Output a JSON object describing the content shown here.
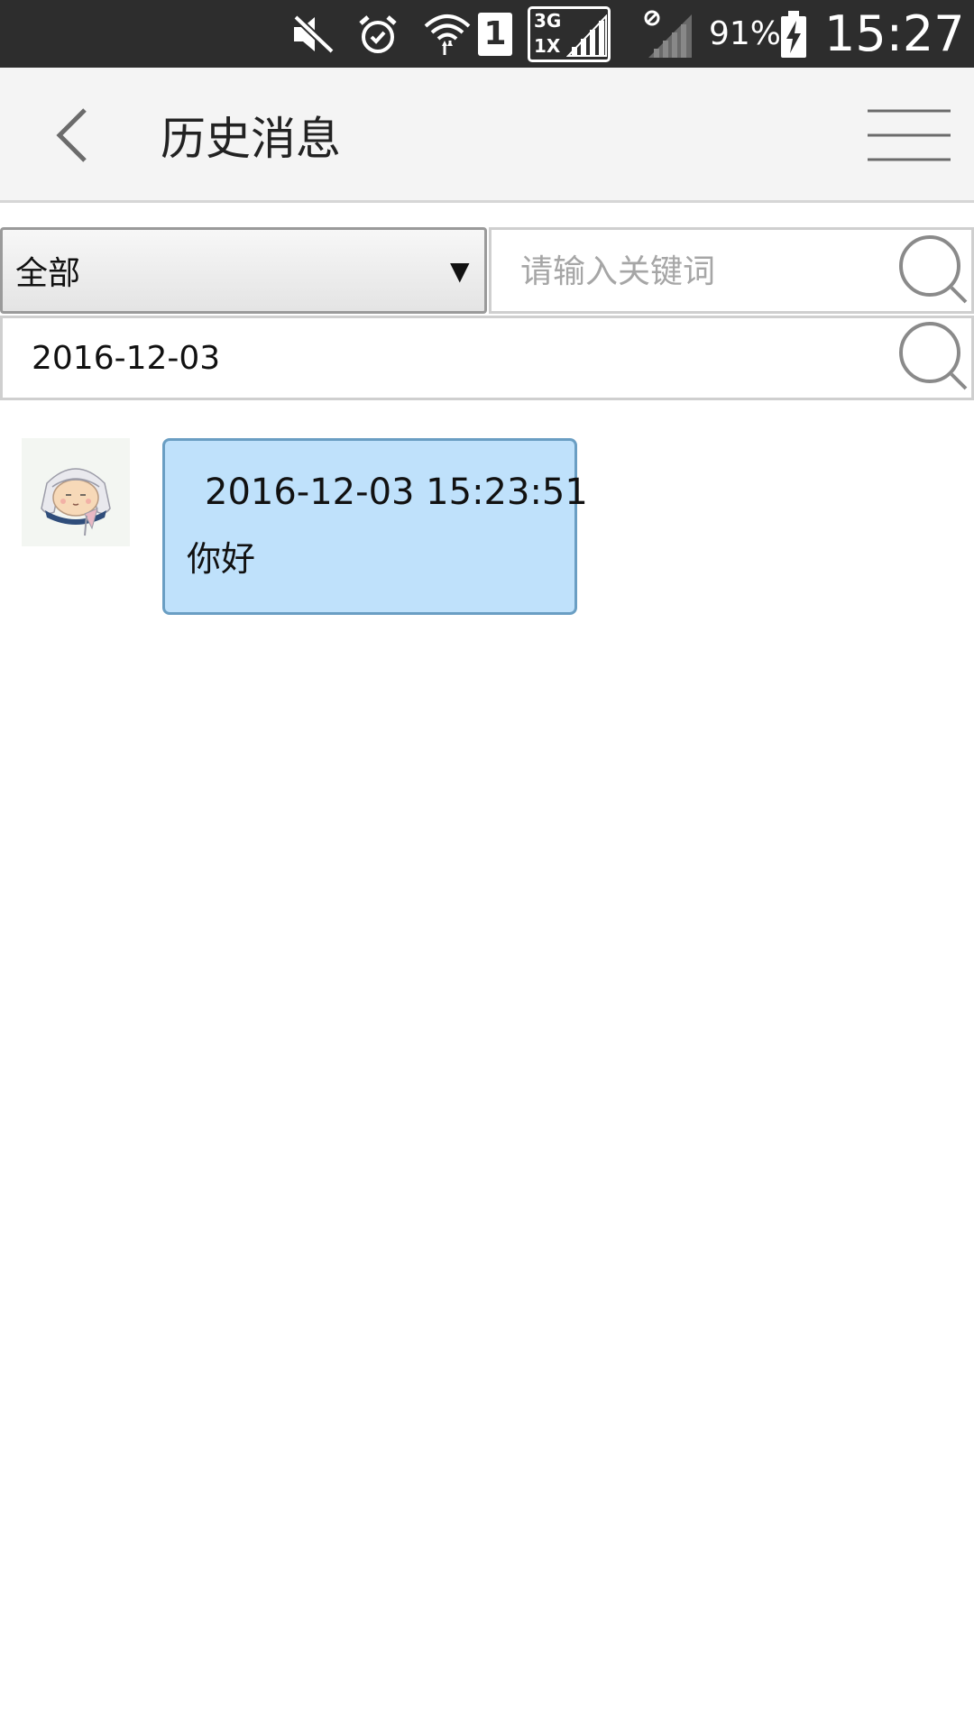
{
  "status_bar": {
    "battery_percent": "91%",
    "time": "15:27",
    "sim_number": "1",
    "network_top": "3G",
    "network_bottom": "1X",
    "icons": [
      "mute-icon",
      "alarm-icon",
      "wifi-icon",
      "sim-icon",
      "network-3g-1x-icon",
      "no-sim-icon",
      "signal-icon",
      "battery-charging-icon"
    ]
  },
  "header": {
    "title": "历史消息",
    "back_icon": "chevron-left-icon",
    "menu_icon": "hamburger-menu-icon"
  },
  "filters": {
    "category_selected": "全部",
    "category_arrow": "▼",
    "keyword_value": "",
    "keyword_placeholder": "请输入关键词",
    "date_value": "2016-12-03",
    "search_icon": "search-icon"
  },
  "messages": [
    {
      "timestamp": "2016-12-03 15:23:51",
      "text": "你好",
      "avatar": "cartoon-avatar"
    }
  ],
  "colors": {
    "status_bar_bg": "#2d2d2d",
    "app_bar_bg": "#f4f4f4",
    "bubble_bg": "#bfe1fb",
    "bubble_border": "#6a9ec3",
    "placeholder": "#a6a6a6"
  }
}
